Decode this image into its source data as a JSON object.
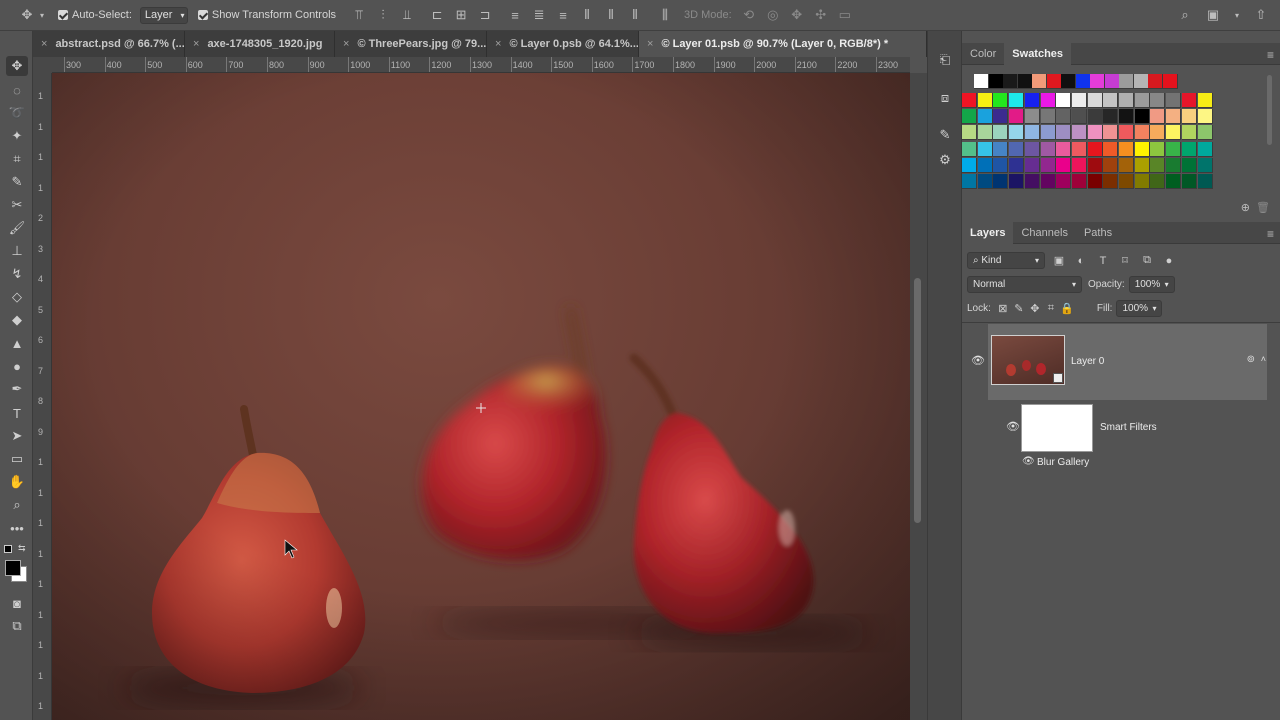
{
  "options_bar": {
    "auto_select_label": "Auto-Select:",
    "auto_select_value": "Layer",
    "show_transform_label": "Show Transform Controls",
    "mode_3d_label": "3D Mode:"
  },
  "tabs": [
    {
      "label": "abstract.psd @ 66.7% (..."
    },
    {
      "label": "axe-1748305_1920.jpg"
    },
    {
      "label": "© ThreePears.jpg @ 79..."
    },
    {
      "label": "© Layer 0.psb @ 64.1%..."
    },
    {
      "label": "© Layer 01.psb @ 90.7% (Layer 0, RGB/8*) *"
    }
  ],
  "ruler_top": [
    "300",
    "400",
    "500",
    "600",
    "700",
    "800",
    "900",
    "1000",
    "1100",
    "1200",
    "1300",
    "1400",
    "1500",
    "1600",
    "1700",
    "1800",
    "1900",
    "2000",
    "2100",
    "2200",
    "2300"
  ],
  "ruler_left": [
    "1",
    "1",
    "1",
    "1",
    "2",
    "3",
    "4",
    "5",
    "6",
    "7",
    "8",
    "9",
    "1",
    "1",
    "1",
    "1",
    "1",
    "1",
    "1",
    "1",
    "1"
  ],
  "color_panel": {
    "tab_color": "Color",
    "tab_swatches": "Swatches"
  },
  "layers_panel": {
    "tab_layers": "Layers",
    "tab_channels": "Channels",
    "tab_paths": "Paths",
    "kind_label": "Kind",
    "blend_mode": "Normal",
    "opacity_label": "Opacity:",
    "opacity_value": "100%",
    "lock_label": "Lock:",
    "fill_label": "Fill:",
    "fill_value": "100%",
    "layer_name": "Layer 0",
    "smart_filters_label": "Smart Filters",
    "filter_name": "Blur Gallery"
  },
  "icons": {
    "move": "move-tool-icon",
    "search": "search-icon",
    "workspace": "workspace-icon"
  },
  "colors": {
    "accent_panel": "#535353",
    "dark_bar": "#3d3d3d",
    "canvas_bg": "#6a3e35"
  }
}
